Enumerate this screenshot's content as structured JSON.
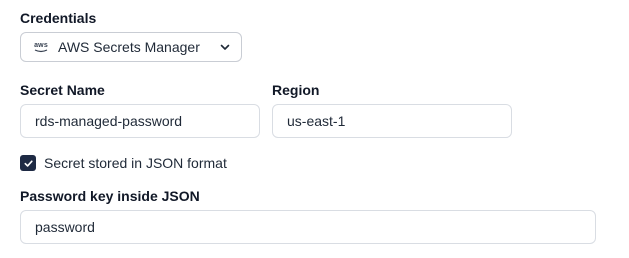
{
  "credentials": {
    "label": "Credentials",
    "provider": "AWS Secrets Manager",
    "provider_icon": "aws-logo-icon",
    "dropdown_icon": "chevron-down-icon"
  },
  "secret_name": {
    "label": "Secret Name",
    "value": "rds-managed-password"
  },
  "region": {
    "label": "Region",
    "value": "us-east-1"
  },
  "json_format": {
    "label": "Secret stored in JSON format",
    "checked": true
  },
  "password_key": {
    "label": "Password key inside JSON",
    "value": "password"
  },
  "colors": {
    "checkbox_fill": "#1e2a44",
    "border": "#d9dde3"
  }
}
